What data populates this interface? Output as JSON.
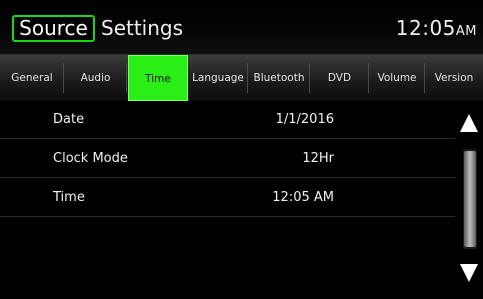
{
  "header": {
    "source_label": "Source",
    "title": "Settings",
    "clock_time": "12:05",
    "clock_ampm": "AM"
  },
  "tabs": [
    {
      "label": "General"
    },
    {
      "label": "Audio"
    },
    {
      "label": "Time"
    },
    {
      "label": "Language"
    },
    {
      "label": "Bluetooth"
    },
    {
      "label": "DVD"
    },
    {
      "label": "Volume"
    },
    {
      "label": "Version"
    }
  ],
  "active_tab": "Time",
  "rows": [
    {
      "label": "Date",
      "value": "1/1/2016"
    },
    {
      "label": "Clock Mode",
      "value": "12Hr"
    },
    {
      "label": "Time",
      "value": "12:05 AM"
    }
  ],
  "colors": {
    "accent": "#2aee16",
    "background": "#000000"
  },
  "icons": {
    "scroll_up": "triangle-up-icon",
    "scroll_down": "triangle-down-icon"
  }
}
